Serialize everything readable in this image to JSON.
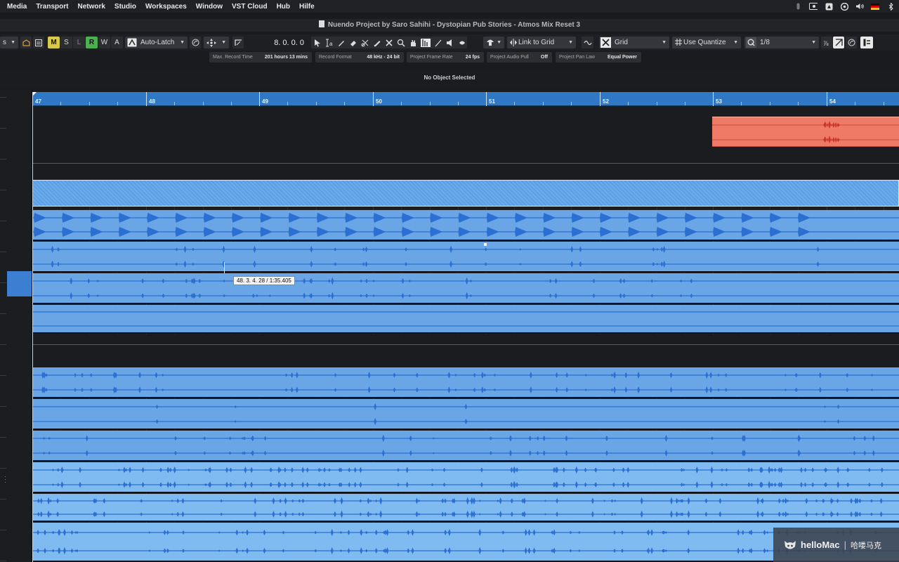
{
  "menubar": {
    "items": [
      "Media",
      "Transport",
      "Network",
      "Studio",
      "Workspaces",
      "Window",
      "VST Cloud",
      "Hub",
      "Hilfe"
    ],
    "status_icons": [
      "mic-indicator-icon",
      "screen-record-icon",
      "cleanmymac-icon",
      "at-sign-icon",
      "volume-icon",
      "german-flag-icon",
      "bluetooth-icon"
    ]
  },
  "window": {
    "title": "Nuendo Project by Saro Sahihi - Dystopian Pub Stories - Atmos Mix Reset 3"
  },
  "toolbar": {
    "left_partial_label": "s",
    "mute_label": "M",
    "solo_label": "S",
    "listen_label": "L",
    "read_label": "R",
    "write_label": "W",
    "a_label": "A",
    "automation_mode": "Auto-Latch",
    "position_display": "8. 0. 0. 0",
    "snap_mode": "Link to Grid",
    "grid_type": "Grid",
    "quantize_mode": "Use Quantize",
    "quantize_value": "1/8",
    "colors": {
      "mute": "#d7c94a",
      "read": "#4bb04f"
    }
  },
  "infoline": [
    {
      "label": "Max. Record Time",
      "value": "201 hours 13 mins"
    },
    {
      "label": "Record Format",
      "value": "48 kHz - 24 bit"
    },
    {
      "label": "Project Frame Rate",
      "value": "24 fps"
    },
    {
      "label": "Project Audio Pull",
      "value": "Off"
    },
    {
      "label": "Project Pan Law",
      "value": "Equal Power"
    }
  ],
  "object_status": "No Object Selected",
  "ruler": {
    "bars": [
      "47",
      "48",
      "49",
      "50",
      "51",
      "52",
      "53",
      "54"
    ]
  },
  "tooltip": "48. 3. 4. 28 / 1:35.405",
  "colors": {
    "ruler": "#2e78c6",
    "audio_event": "#6aa5e6",
    "selected_event": "#ef7a66",
    "waveform": "#2a6fd1"
  },
  "watermark": {
    "brand": "helloMac",
    "separator": "|",
    "chinese": "哈喽马克"
  }
}
